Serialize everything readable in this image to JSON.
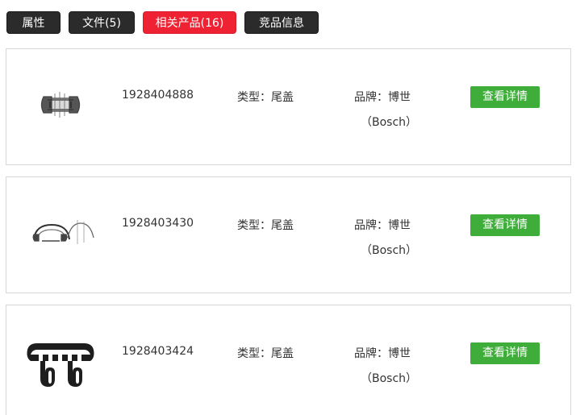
{
  "tabs": [
    {
      "label": "属性",
      "active": false
    },
    {
      "label": "文件(5)",
      "active": false
    },
    {
      "label": "相关产品(16)",
      "active": true
    },
    {
      "label": "竞品信息",
      "active": false
    }
  ],
  "colors": {
    "tab_default": "#2b2b2b",
    "tab_active": "#ee2233",
    "button": "#3fad3a",
    "border": "#d8d8d8"
  },
  "products": [
    {
      "image_icon": "end-cover-part-icon",
      "part_number": "1928404888",
      "type": "类型：尾盖",
      "brand": "品牌：博世",
      "brand_sub": "（Bosch）",
      "button_label": "查看详情"
    },
    {
      "image_icon": "end-cover-part-icon",
      "part_number": "1928403430",
      "type": "类型：尾盖",
      "brand": "品牌：博世",
      "brand_sub": "（Bosch）",
      "button_label": "查看详情"
    },
    {
      "image_icon": "end-cover-part-icon",
      "part_number": "1928403424",
      "type": "类型：尾盖",
      "brand": "品牌：博世",
      "brand_sub": "（Bosch）",
      "button_label": "查看详情"
    }
  ]
}
